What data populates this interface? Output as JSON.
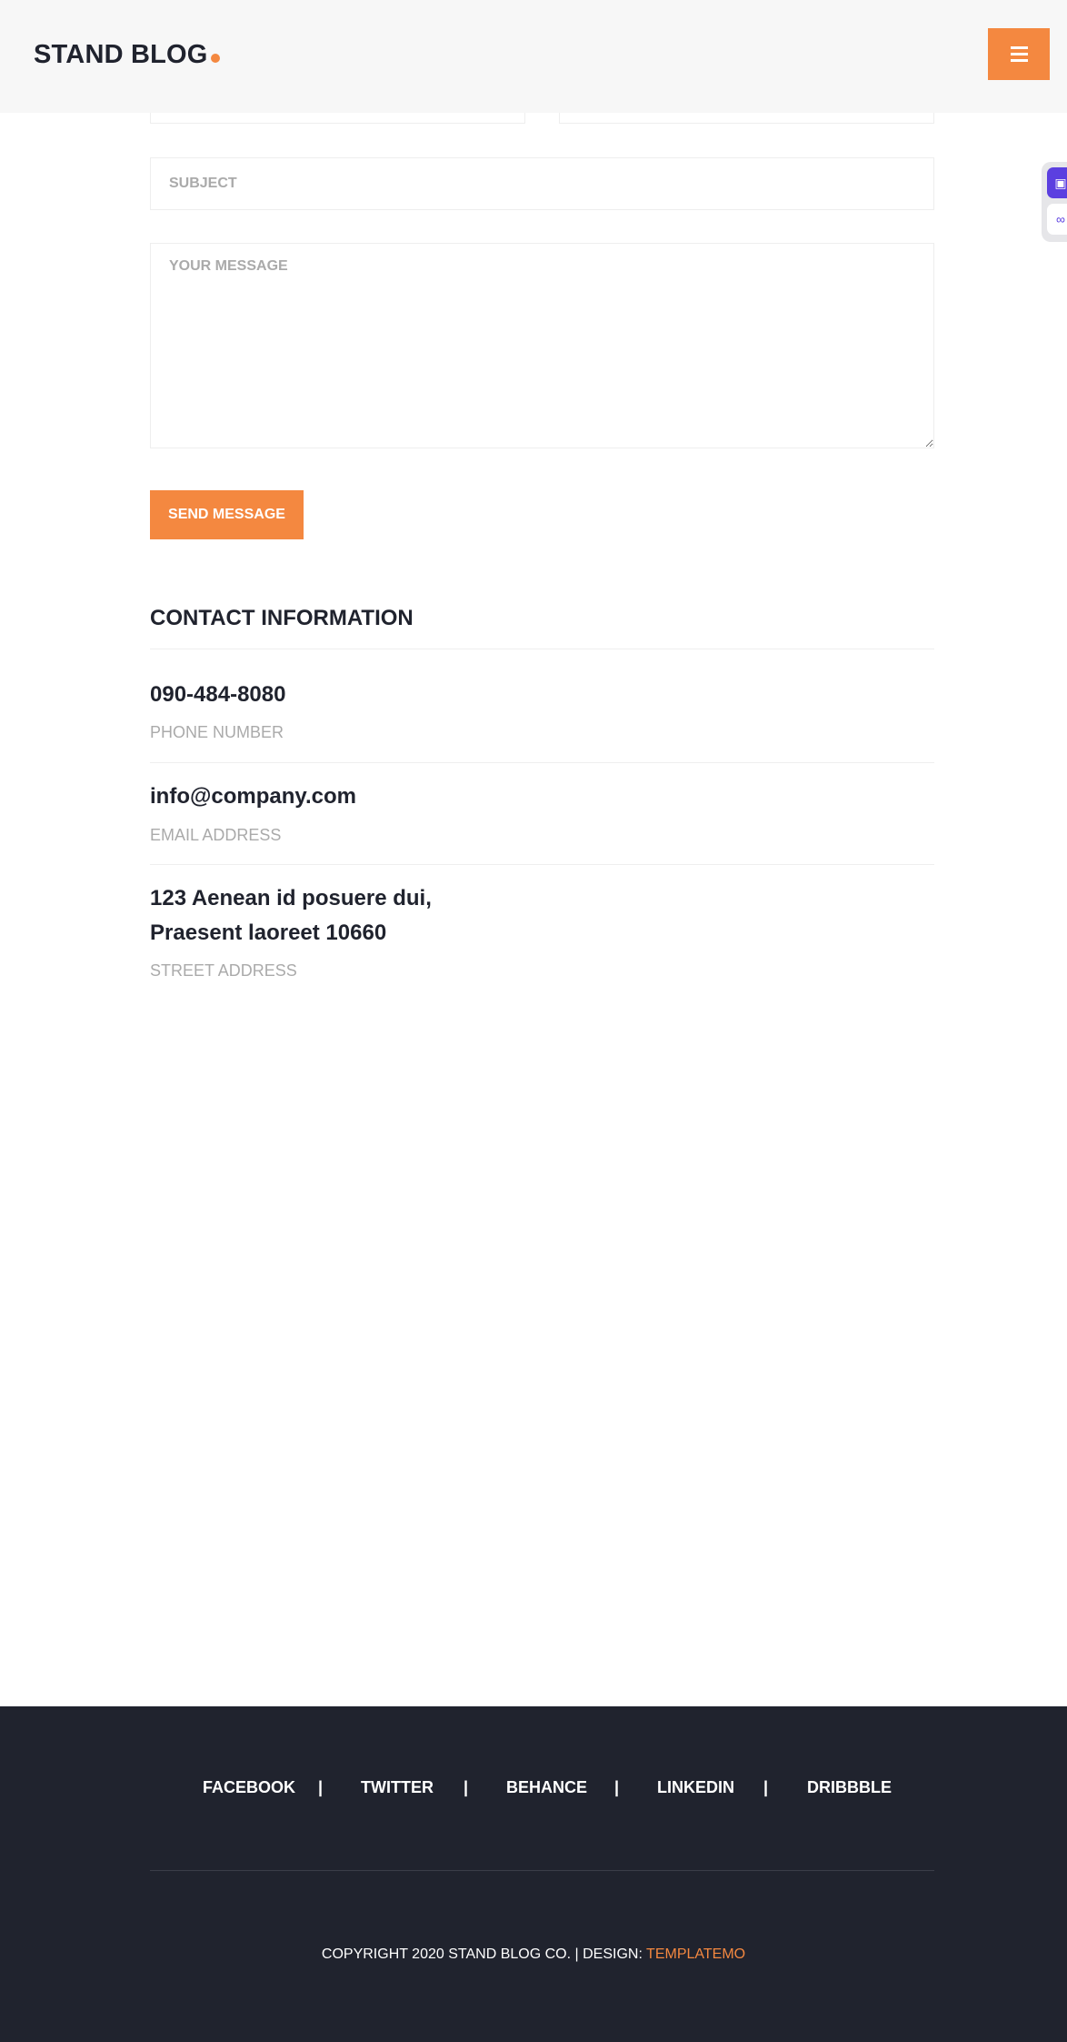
{
  "header": {
    "logo": "STAND BLOG",
    "menu_icon": "hamburger-icon"
  },
  "side_widget": {
    "icons": [
      "translate-icon",
      "chinese-language-icon"
    ]
  },
  "form": {
    "subject_placeholder": "SUBJECT",
    "message_placeholder": "YOUR MESSAGE",
    "send_label": "SEND MESSAGE"
  },
  "contact": {
    "title": "CONTACT INFORMATION",
    "phone": {
      "value": "090-484-8080",
      "label": "PHONE NUMBER"
    },
    "email": {
      "value": "info@company.com",
      "label": "EMAIL ADDRESS"
    },
    "address": {
      "line1": "123 Aenean id posuere dui,",
      "line2": "Praesent laoreet 10660",
      "label": "STREET ADDRESS"
    }
  },
  "footer": {
    "social": [
      "FACEBOOK",
      "TWITTER",
      "BEHANCE",
      "LINKEDIN",
      "DRIBBBLE"
    ],
    "separator": "|",
    "copyright": "COPYRIGHT 2020 STAND BLOG CO. | DESIGN: ",
    "design_link": "TEMPLATEMO"
  },
  "colors": {
    "accent": "#f48840",
    "dark": "#20232e",
    "muted": "#aaaaaa"
  }
}
